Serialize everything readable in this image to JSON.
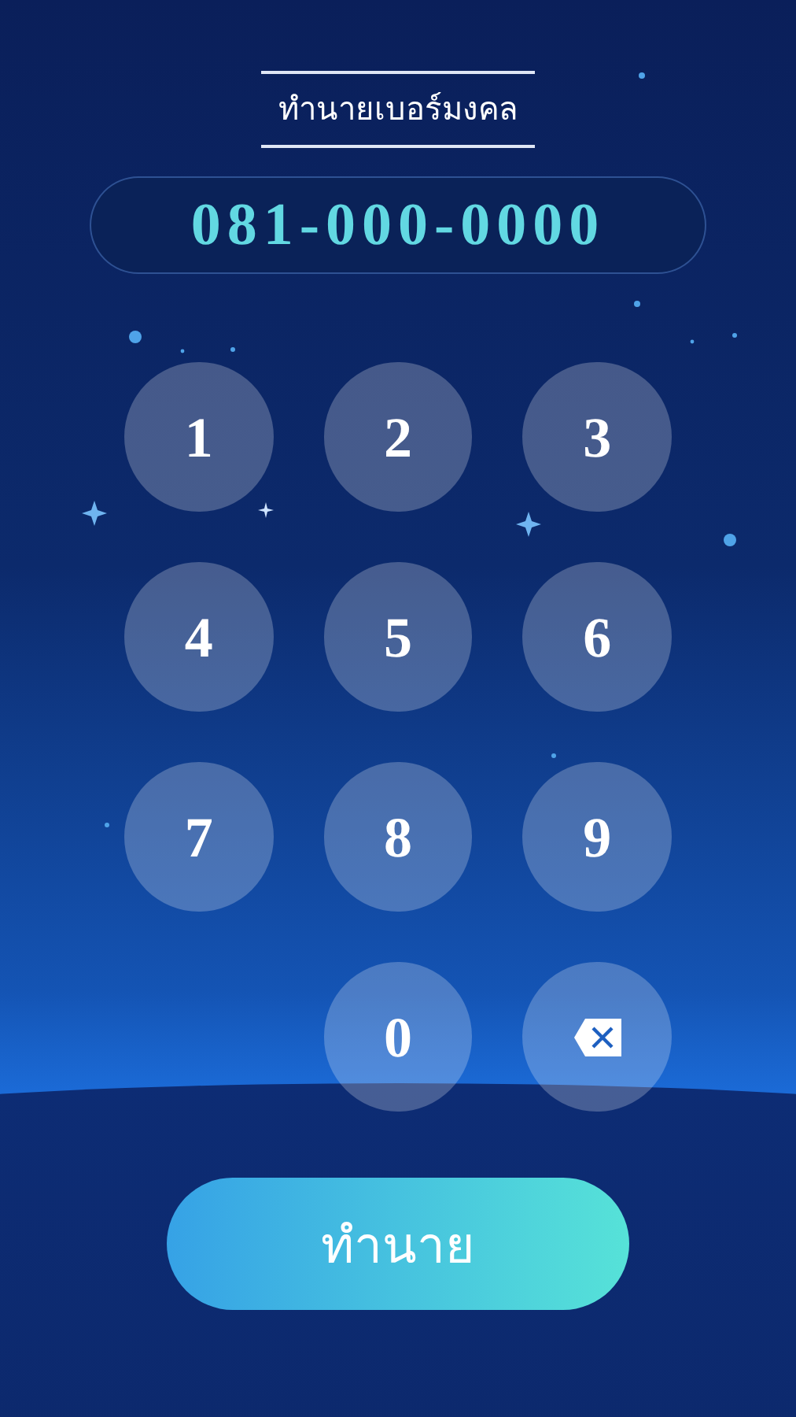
{
  "title": "ทำนายเบอร์มงคล",
  "phone_display": {
    "value": "081-000-0000"
  },
  "keypad": {
    "rows": [
      [
        {
          "kind": "digit",
          "label": "1"
        },
        {
          "kind": "digit",
          "label": "2"
        },
        {
          "kind": "digit",
          "label": "3"
        }
      ],
      [
        {
          "kind": "digit",
          "label": "4"
        },
        {
          "kind": "digit",
          "label": "5"
        },
        {
          "kind": "digit",
          "label": "6"
        }
      ],
      [
        {
          "kind": "digit",
          "label": "7"
        },
        {
          "kind": "digit",
          "label": "8"
        },
        {
          "kind": "digit",
          "label": "9"
        }
      ],
      [
        {
          "kind": "blank"
        },
        {
          "kind": "digit",
          "label": "0"
        },
        {
          "kind": "backspace"
        }
      ]
    ]
  },
  "predict_button": {
    "label": "ทำนาย"
  }
}
